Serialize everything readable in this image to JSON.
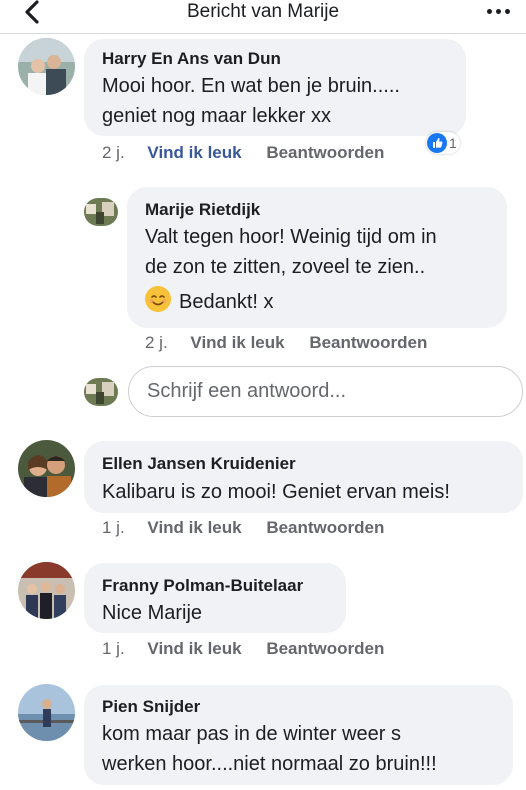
{
  "header": {
    "title": "Bericht van Marije"
  },
  "actions": {
    "like": "Vind ik leuk",
    "reply": "Beantwoorden"
  },
  "comments": [
    {
      "author": "Harry En Ans van Dun",
      "lines": [
        "Mooi hoor. En wat ben je bruin.....",
        "geniet nog maar lekker xx"
      ],
      "time": "2 j.",
      "reaction_count": "1",
      "reaction_icon": "thumbs-up-icon"
    },
    {
      "author": "Marije Rietdijk",
      "lines": [
        "Valt tegen hoor! Weinig tijd om in",
        "de zon te zitten, zoveel te zien..",
        "Bedankt! x"
      ],
      "time": "2 j."
    },
    {
      "author": "Ellen Jansen Kruidenier",
      "lines": [
        "Kalibaru is zo mooi! Geniet ervan meis!"
      ],
      "time": "1 j."
    },
    {
      "author": "Franny Polman-Buitelaar",
      "lines": [
        "Nice Marije"
      ],
      "time": "1 j."
    },
    {
      "author": "Pien Snijder",
      "lines": [
        "kom maar pas in de winter weer s",
        "werken hoor....niet normaal zo bruin!!!"
      ]
    }
  ],
  "reply_box": {
    "placeholder": "Schrijf een antwoord..."
  },
  "colors": {
    "link_blue": "#385898",
    "muted": "#65676b",
    "bubble": "#f0f2f5",
    "like_blue": "#1877f2"
  }
}
